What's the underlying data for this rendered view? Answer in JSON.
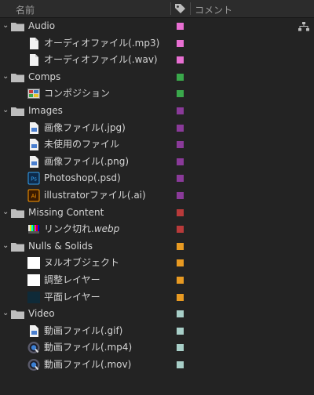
{
  "header": {
    "name_label": "名前",
    "comment_label": "コメント"
  },
  "colors": {
    "pink": "#e86fd2",
    "green": "#3aa84b",
    "purple": "#8a3a99",
    "red": "#b83a3a",
    "orange": "#e89a22",
    "teal": "#a8cfc8"
  },
  "items": {
    "audio": "Audio",
    "audio_1": "オーディオファイル(.mp3)",
    "audio_2": "オーディオファイル(.wav)",
    "comps": "Comps",
    "comps_1": "コンポジション",
    "images": "Images",
    "images_1": "画像ファイル(.jpg)",
    "images_2": "未使用のファイル",
    "images_3": "画像ファイル(.png)",
    "images_4": "Photoshop(.psd)",
    "images_5": "illustratorファイル(.ai)",
    "missing": "Missing Content",
    "missing_1_a": "リンク切れ.",
    "missing_1_b": "webp",
    "nulls": "Nulls & Solids",
    "nulls_1": "ヌルオブジェクト",
    "nulls_2": "調整レイヤー",
    "nulls_3": "平面レイヤー",
    "video": "Video",
    "video_1": "動画ファイル(.gif)",
    "video_2": "動画ファイル(.mp4)",
    "video_3": "動画ファイル(.mov)"
  },
  "icons": {
    "tag": "tag-icon",
    "folder": "folder-icon",
    "flowchart": "flowchart-icon"
  }
}
